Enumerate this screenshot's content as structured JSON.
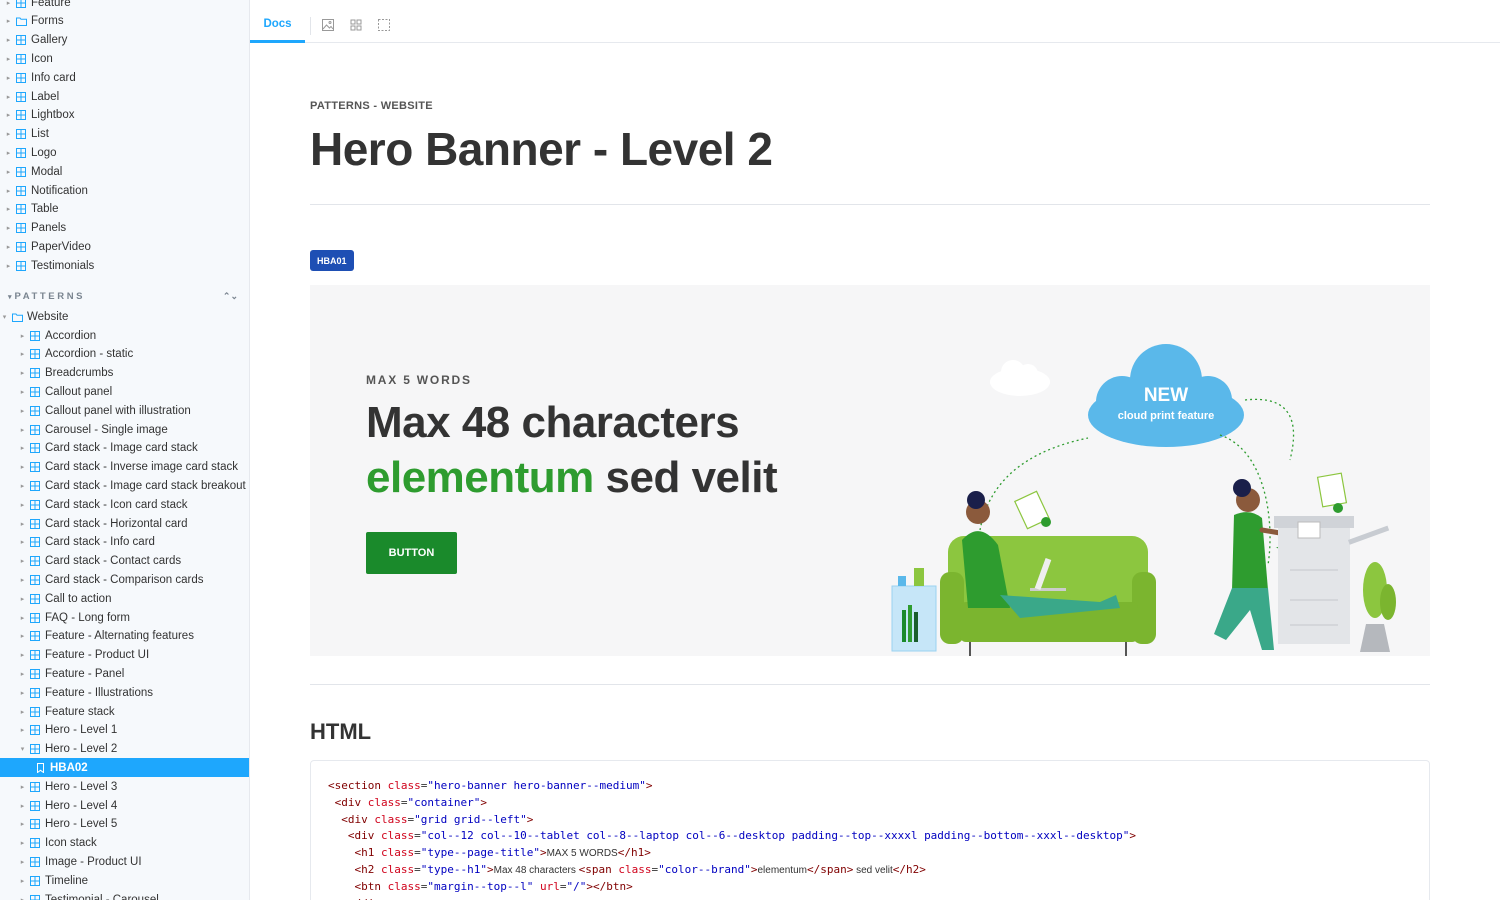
{
  "sidebar": {
    "components_items": [
      {
        "label": "Feature"
      },
      {
        "label": "Forms",
        "icon": "folder-icon"
      },
      {
        "label": "Gallery"
      },
      {
        "label": "Icon"
      },
      {
        "label": "Info card"
      },
      {
        "label": "Label"
      },
      {
        "label": "Lightbox"
      },
      {
        "label": "List"
      },
      {
        "label": "Logo"
      },
      {
        "label": "Modal"
      },
      {
        "label": "Notification"
      },
      {
        "label": "Table"
      },
      {
        "label": "Panels"
      },
      {
        "label": "PaperVideo"
      },
      {
        "label": "Testimonials"
      }
    ],
    "patterns_heading": "PATTERNS",
    "website_folder": "Website",
    "website_items": [
      {
        "label": "Accordion"
      },
      {
        "label": "Accordion - static"
      },
      {
        "label": "Breadcrumbs"
      },
      {
        "label": "Callout panel"
      },
      {
        "label": "Callout panel with illustration"
      },
      {
        "label": "Carousel - Single image"
      },
      {
        "label": "Card stack - Image card stack"
      },
      {
        "label": "Card stack - Inverse image card stack"
      },
      {
        "label": "Card stack - Image card stack breakout"
      },
      {
        "label": "Card stack - Icon card stack"
      },
      {
        "label": "Card stack - Horizontal card"
      },
      {
        "label": "Card stack - Info card"
      },
      {
        "label": "Card stack - Contact cards"
      },
      {
        "label": "Card stack - Comparison cards"
      },
      {
        "label": "Call to action"
      },
      {
        "label": "FAQ - Long form"
      },
      {
        "label": "Feature - Alternating features"
      },
      {
        "label": "Feature - Product UI"
      },
      {
        "label": "Feature - Panel"
      },
      {
        "label": "Feature - Illustrations"
      },
      {
        "label": "Feature stack"
      },
      {
        "label": "Hero - Level 1"
      },
      {
        "label": "Hero - Level 2",
        "expanded": true
      },
      {
        "label": "HBA02",
        "selected": true,
        "story": true
      },
      {
        "label": "Hero - Level 3"
      },
      {
        "label": "Hero - Level 4"
      },
      {
        "label": "Hero - Level 5"
      },
      {
        "label": "Icon stack"
      },
      {
        "label": "Image - Product UI"
      },
      {
        "label": "Timeline"
      },
      {
        "label": "Testimonial - Carousel"
      }
    ]
  },
  "toolbar": {
    "docs_tab": "Docs",
    "tools": [
      "image-icon",
      "grid-icon",
      "outline-icon"
    ]
  },
  "main": {
    "eyebrow": "PATTERNS - WEBSITE",
    "title": "Hero Banner - Level 2",
    "badge": "HBA01",
    "hero": {
      "eyebrow": "MAX 5 WORDS",
      "title_line1": "Max 48 characters",
      "title_brand": "elementum",
      "title_rest": " sed velit",
      "button": "BUTTON",
      "cloud_new": "NEW",
      "cloud_sub": "cloud print feature"
    },
    "html_heading": "HTML"
  },
  "colors": {
    "accent": "#1ea7fd",
    "badge": "#1e4fb4",
    "brand_green": "#2e9c2f",
    "button_green": "#1a8a2b"
  }
}
